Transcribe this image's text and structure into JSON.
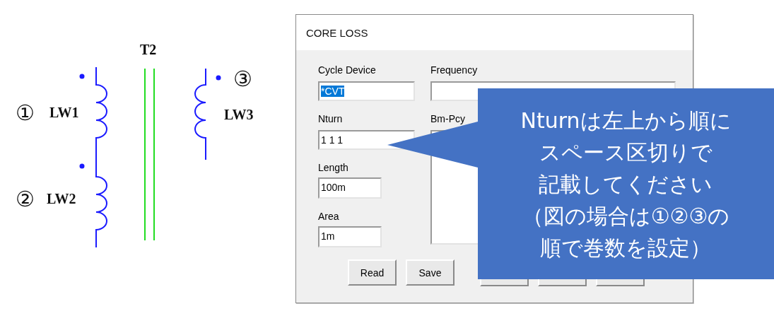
{
  "schematic": {
    "title": "T2",
    "windings": [
      {
        "number": "①",
        "label": "LW1",
        "kind": "left"
      },
      {
        "number": "②",
        "label": "LW2",
        "kind": "left"
      },
      {
        "number": "③",
        "label": "LW3",
        "kind": "right"
      }
    ]
  },
  "dialog": {
    "title": "CORE LOSS",
    "fields": [
      {
        "label": "Cycle Device",
        "value": "*CVT",
        "selected": true,
        "kind": "short"
      },
      {
        "label": "Nturn",
        "value": "1 1 1",
        "selected": false,
        "kind": "short"
      },
      {
        "label": "Length",
        "value": "100m",
        "selected": false,
        "kind": "narrow"
      },
      {
        "label": "Area",
        "value": "1m",
        "selected": false,
        "kind": "narrow"
      }
    ],
    "right_fields": [
      {
        "label": "Frequency",
        "kind": "line"
      },
      {
        "label": "Bm-Pcy",
        "kind": "area"
      }
    ],
    "buttons": [
      "Read",
      "Save"
    ]
  },
  "callout": {
    "lines": [
      "Nturnは左上から順に",
      "スペース区切りで",
      "記載してください",
      "（図の場合は①②③の",
      "順で巻数を設定）"
    ]
  }
}
